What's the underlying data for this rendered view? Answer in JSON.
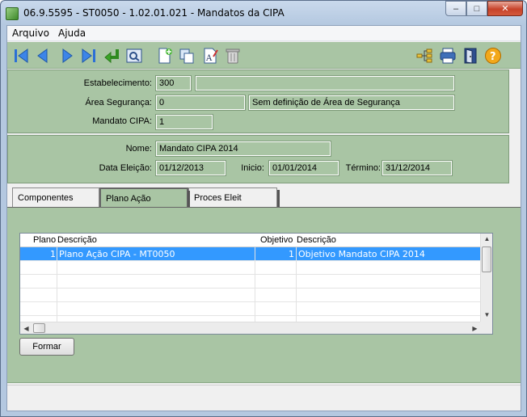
{
  "window": {
    "title": "06.9.5595 - ST0050 - 1.02.01.021 - Mandatos da CIPA",
    "controls": {
      "minimize": "–",
      "maximize": "□",
      "close": "✕"
    }
  },
  "menu": {
    "items": [
      "Arquivo",
      "Ajuda"
    ]
  },
  "toolbar": {
    "left_icons": [
      "first-record-icon",
      "previous-record-icon",
      "next-record-icon",
      "last-record-icon",
      "goto-icon",
      "zoom-search-icon",
      "new-record-icon",
      "copy-record-icon",
      "edit-record-icon",
      "delete-record-icon"
    ],
    "right_icons": [
      "navigation-tree-icon",
      "print-icon",
      "exit-door-icon",
      "help-icon"
    ]
  },
  "header_panel": {
    "estabelecimento": {
      "label": "Estabelecimento:",
      "value": "300",
      "description": ""
    },
    "area_seguranca": {
      "label": "Área Segurança:",
      "value": "0",
      "description": "Sem definição de Área de Segurança"
    },
    "mandato_cipa": {
      "label": "Mandato CIPA:",
      "value": "1"
    }
  },
  "detail_panel": {
    "nome": {
      "label": "Nome:",
      "value": "Mandato CIPA 2014"
    },
    "data_eleicao": {
      "label": "Data Eleição:",
      "value": "01/12/2013"
    },
    "inicio": {
      "label": "Inicio:",
      "value": "01/01/2014"
    },
    "termino": {
      "label": "Término:",
      "value": "31/12/2014"
    }
  },
  "tabs": [
    {
      "label": "Componentes",
      "active": false
    },
    {
      "label": "Plano Ação",
      "active": true
    },
    {
      "label": "Proces Eleit",
      "active": false
    }
  ],
  "grid": {
    "columns": [
      "Plano",
      "Descrição",
      "Objetivo",
      "Descrição"
    ],
    "rows": [
      {
        "plano": "1",
        "descricao": "Plano Ação CIPA - MT0050",
        "objetivo": "1",
        "objetivo_descricao": "Objetivo Mandato CIPA 2014"
      }
    ]
  },
  "buttons": {
    "formar": "Formar"
  },
  "colors": {
    "panel_green": "#a9c5a4",
    "selection_blue": "#3399ff",
    "title_gradient": "#b4c8e0"
  }
}
